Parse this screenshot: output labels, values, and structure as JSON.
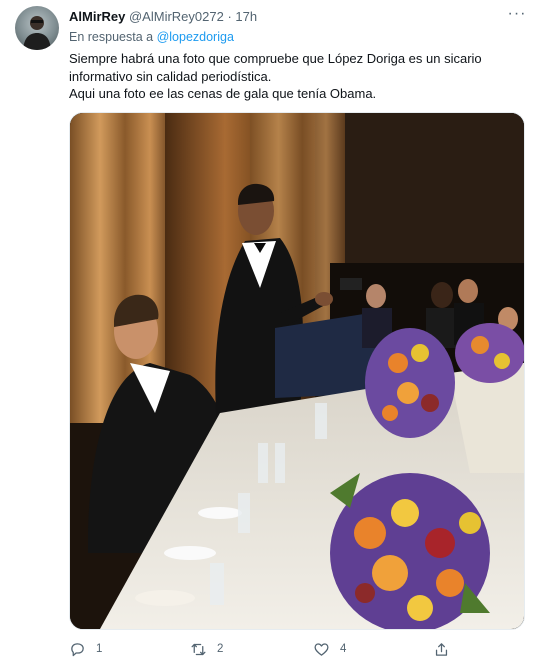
{
  "tweet": {
    "display_name": "AlMirRey",
    "handle": "@AlMirRey0272",
    "separator": "·",
    "time": "17h",
    "more_label": "···",
    "reply_to_prefix": "En respuesta a",
    "reply_to_mention": "@lopezdoriga",
    "text_lines": [
      "Siempre habrá una foto que compruebe que López Doriga es un sicario",
      "informativo sin calidad periodística.",
      "Aqui una foto ee las cenas de gala que tenía Obama."
    ],
    "media": {
      "icon": "photo"
    }
  },
  "actions": {
    "reply": {
      "icon": "reply-icon",
      "count": "1"
    },
    "retweet": {
      "icon": "retweet-icon",
      "count": "2"
    },
    "like": {
      "icon": "heart-icon",
      "count": "4"
    },
    "share": {
      "icon": "share-icon",
      "count": ""
    }
  },
  "colors": {
    "accent": "#1d9bf0",
    "secondary_text": "#536471",
    "primary_text": "#0f1419"
  }
}
